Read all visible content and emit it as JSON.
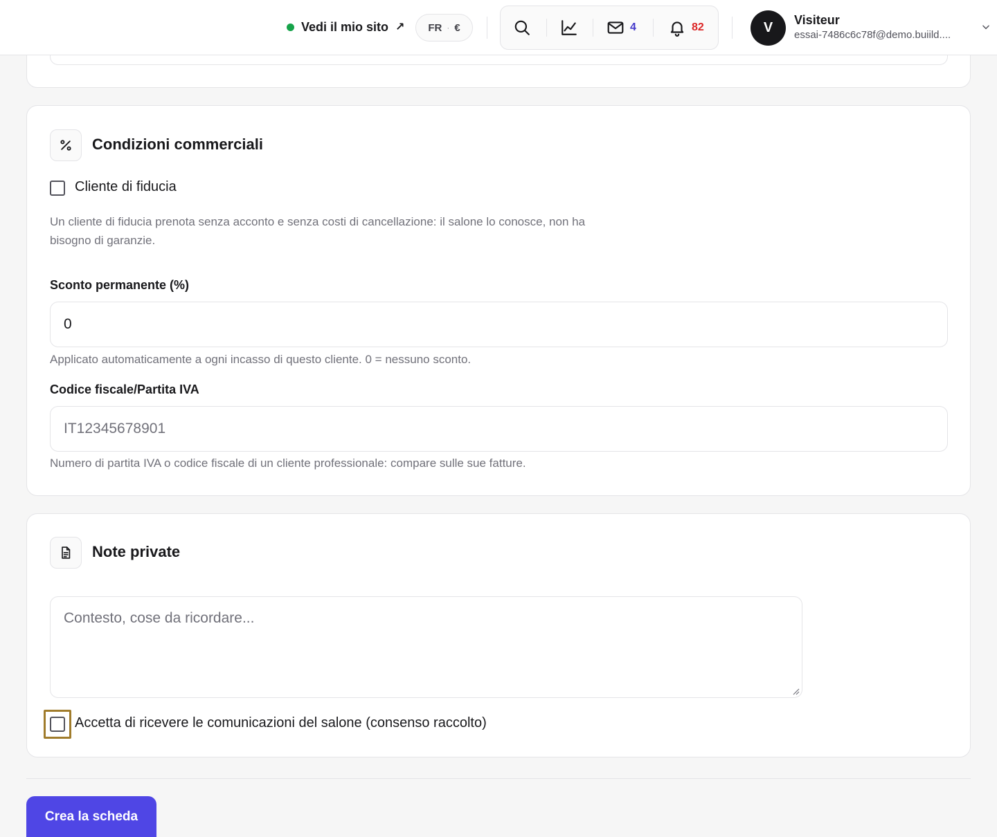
{
  "header": {
    "site_link_label": "Vedi il mio sito",
    "site_link_arrow": "↗",
    "locale": {
      "language": "FR",
      "separator": "·",
      "currency": "€"
    },
    "tools": {
      "search_icon": "search-icon",
      "stats_icon": "chart-line-icon",
      "messages_icon": "mail-icon",
      "messages_count": "4",
      "notifications_icon": "bell-icon",
      "notifications_count": "82"
    },
    "user": {
      "avatar_initial": "V",
      "name": "Visiteur",
      "email": "essai-7486c6c78f@demo.buiild...."
    }
  },
  "commercial": {
    "icon": "percent-icon",
    "title": "Condizioni commerciali",
    "trusted_client_label": "Cliente di fiducia",
    "trusted_client_checked": false,
    "trusted_client_help_line1": "Un cliente di fiducia prenota senza acconto e senza costi di cancellazione: il salone lo conosce, non ha",
    "trusted_client_help_line2": "bisogno di garanzie.",
    "discount_label": "Sconto permanente (%)",
    "discount_value": "0",
    "discount_help": "Applicato automaticamente a ogni incasso di questo cliente. 0 = nessuno sconto.",
    "tax_label": "Codice fiscale/Partita IVA",
    "tax_placeholder": "IT12345678901",
    "tax_help": "Numero di partita IVA o codice fiscale di un cliente professionale: compare sulle sue fatture."
  },
  "notes": {
    "icon": "document-icon",
    "title": "Note private",
    "placeholder": "Contesto, cose da ricordare...",
    "consent_label": "Accetta di ricevere le comunicazioni del salone (consenso raccolto)",
    "consent_checked": false
  },
  "actions": {
    "submit_label": "Crea la scheda"
  },
  "colors": {
    "accent": "#4f46e5",
    "status_online": "#16a34a",
    "messages_count": "#4338ca",
    "notifications_count": "#dc2626",
    "focus_ring": "#a07c2c"
  }
}
